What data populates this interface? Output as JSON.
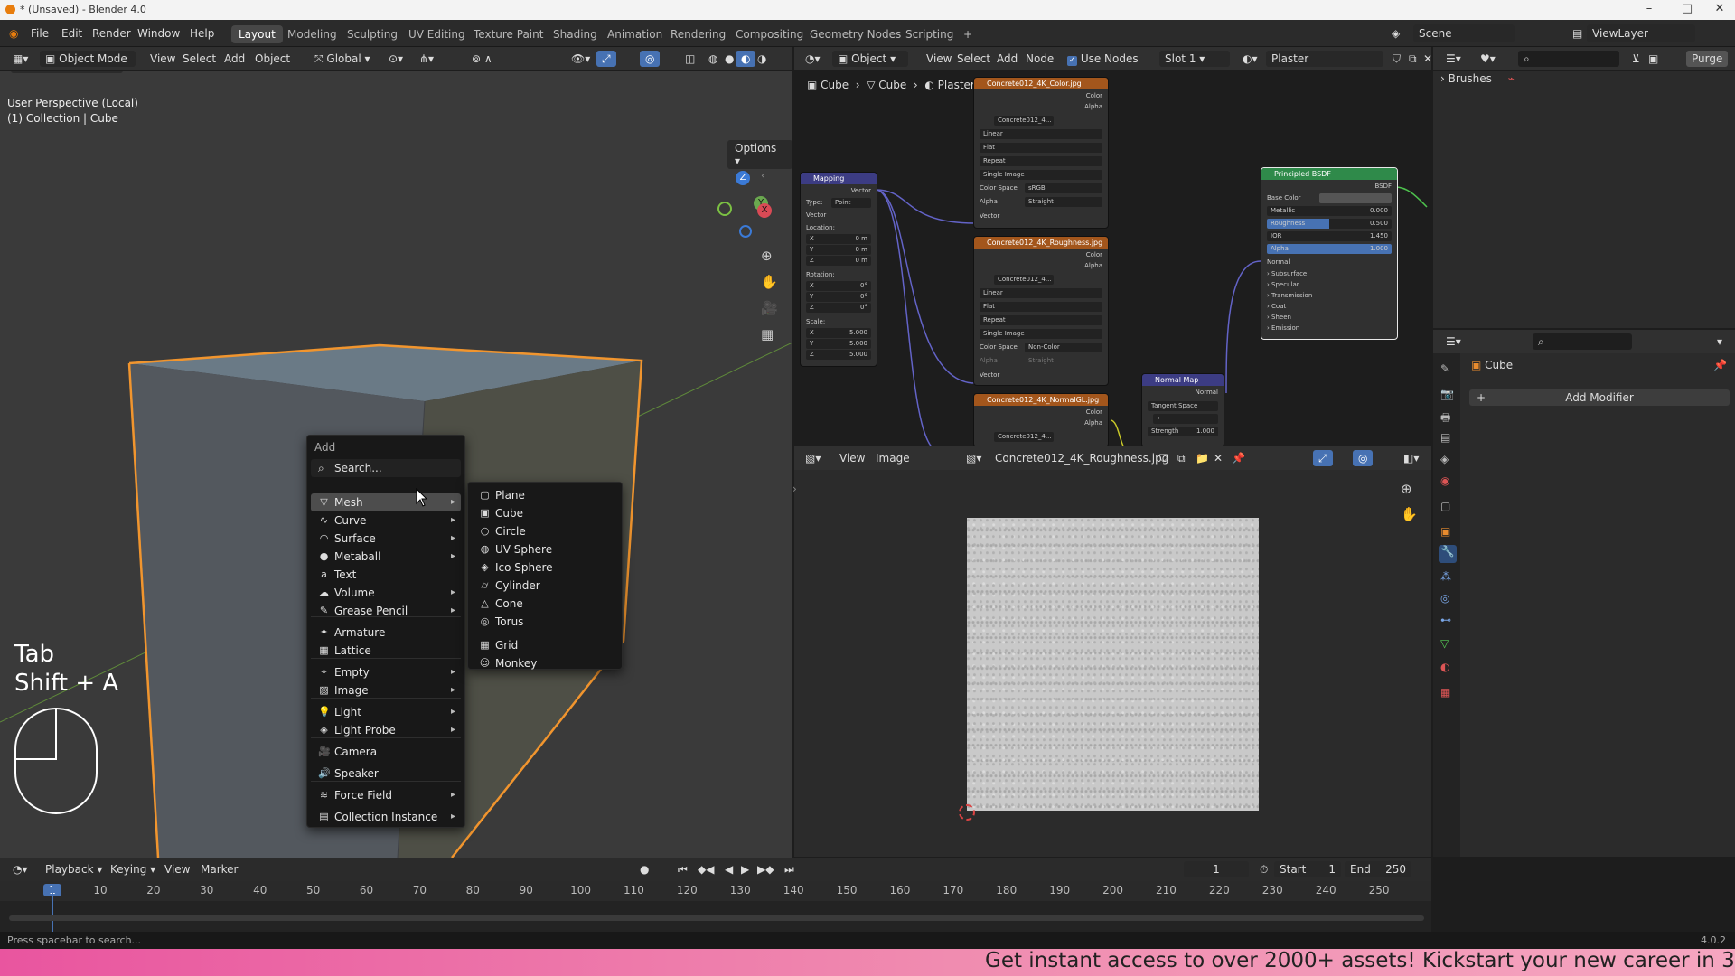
{
  "title_bar": {
    "title": "* (Unsaved) - Blender 4.0"
  },
  "top_menu": {
    "menus": [
      "File",
      "Edit",
      "Render",
      "Window",
      "Help"
    ],
    "workspaces": [
      "Layout",
      "Modeling",
      "Sculpting",
      "UV Editing",
      "Texture Paint",
      "Shading",
      "Animation",
      "Rendering",
      "Compositing",
      "Geometry Nodes",
      "Scripting",
      "+"
    ],
    "active_workspace": "Layout",
    "scene": "Scene",
    "view_layer": "ViewLayer"
  },
  "viewport_header": {
    "mode": "Object Mode",
    "menus": [
      "View",
      "Select",
      "Add",
      "Object"
    ],
    "transform_orientation": "Global",
    "options": "Options"
  },
  "viewport": {
    "perspective_label": "User Perspective (Local)",
    "collection_label": "(1) Collection | Cube",
    "key_hint_1": "Tab",
    "key_hint_2": "Shift + A",
    "gizmo": {
      "z": "Z",
      "y": "Y",
      "x": "X"
    }
  },
  "add_menu": {
    "title": "Add",
    "search": "Search...",
    "items": [
      {
        "label": "Mesh",
        "icon": "mesh-icon",
        "submenu": true
      },
      {
        "label": "Curve",
        "icon": "curve-icon",
        "submenu": true
      },
      {
        "label": "Surface",
        "icon": "surface-icon",
        "submenu": true
      },
      {
        "label": "Metaball",
        "icon": "metaball-icon",
        "submenu": true
      },
      {
        "label": "Text",
        "icon": "text-icon",
        "submenu": false
      },
      {
        "label": "Volume",
        "icon": "volume-icon",
        "submenu": true
      },
      {
        "label": "Grease Pencil",
        "icon": "grease-pencil-icon",
        "submenu": true
      },
      {
        "label": "Armature",
        "icon": "armature-icon",
        "submenu": false
      },
      {
        "label": "Lattice",
        "icon": "lattice-icon",
        "submenu": false
      },
      {
        "label": "Empty",
        "icon": "empty-icon",
        "submenu": true
      },
      {
        "label": "Image",
        "icon": "image-icon",
        "submenu": true
      },
      {
        "label": "Light",
        "icon": "light-icon",
        "submenu": true
      },
      {
        "label": "Light Probe",
        "icon": "light-probe-icon",
        "submenu": true
      },
      {
        "label": "Camera",
        "icon": "camera-icon",
        "submenu": false
      },
      {
        "label": "Speaker",
        "icon": "speaker-icon",
        "submenu": false
      },
      {
        "label": "Force Field",
        "icon": "force-field-icon",
        "submenu": true
      },
      {
        "label": "Collection Instance",
        "icon": "collection-icon",
        "submenu": true
      }
    ],
    "mesh_submenu": [
      "Plane",
      "Cube",
      "Circle",
      "UV Sphere",
      "Ico Sphere",
      "Cylinder",
      "Cone",
      "Torus",
      "Grid",
      "Monkey"
    ]
  },
  "node_header": {
    "object": "Object",
    "menus": [
      "View",
      "Select",
      "Add",
      "Node"
    ],
    "use_nodes": "Use Nodes",
    "slot": "Slot 1",
    "material": "Plaster"
  },
  "node_breadcrumb": [
    "Cube",
    "Cube",
    "Plaster"
  ],
  "nodes": {
    "mapping": {
      "title": "Mapping",
      "vector": "Vector",
      "type_label": "Type:",
      "type_value": "Point",
      "vector_in": "Vector",
      "location": "Location:",
      "loc": [
        "0 m",
        "0 m",
        "0 m"
      ],
      "rotation": "Rotation:",
      "rot": [
        "0°",
        "0°",
        "0°"
      ],
      "scale": "Scale:",
      "scl": [
        "5.000",
        "5.000",
        "5.000"
      ],
      "axes": [
        "X",
        "Y",
        "Z"
      ]
    },
    "color_tex": {
      "title": "Concrete012_4K_Color.jpg",
      "out1": "Color",
      "out2": "Alpha",
      "image": "Concrete012_4...",
      "interp": "Linear",
      "proj": "Flat",
      "ext": "Repeat",
      "source": "Single Image",
      "cs_label": "Color Space",
      "cs": "sRGB",
      "alpha_label": "Alpha",
      "alpha": "Straight",
      "vec": "Vector"
    },
    "rough_tex": {
      "title": "Concrete012_4K_Roughness.jpg",
      "out1": "Color",
      "out2": "Alpha",
      "image": "Concrete012_4...",
      "interp": "Linear",
      "proj": "Flat",
      "ext": "Repeat",
      "source": "Single Image",
      "cs_label": "Color Space",
      "cs": "Non-Color",
      "alpha_label": "Alpha",
      "alpha": "Straight",
      "vec": "Vector"
    },
    "normal_tex": {
      "title": "Concrete012_4K_NormalGL.jpg",
      "out1": "Color",
      "out2": "Alpha",
      "image": "Concrete012_4..."
    },
    "normal_map": {
      "title": "Normal Map",
      "out": "Normal",
      "space": "Tangent Space",
      "strength_label": "Strength",
      "strength": "1.000"
    },
    "bsdf": {
      "title": "Principled BSDF",
      "out": "BSDF",
      "base_color": "Base Color",
      "metallic": "Metallic",
      "metallic_v": "0.000",
      "roughness": "Roughness",
      "roughness_v": "0.500",
      "ior": "IOR",
      "ior_v": "1.450",
      "alpha": "Alpha",
      "alpha_v": "1.000",
      "normal": "Normal",
      "panels": [
        "Subsurface",
        "Specular",
        "Transmission",
        "Coat",
        "Sheen",
        "Emission"
      ]
    }
  },
  "image_editor": {
    "menus": [
      "View",
      "Image"
    ],
    "image_name": "Concrete012_4K_Roughness.jpg"
  },
  "outliner": {
    "item": "Brushes"
  },
  "properties": {
    "object_name": "Cube",
    "add_modifier": "Add Modifier",
    "purge": "Purge"
  },
  "timeline": {
    "menus": [
      "Playback",
      "Keying",
      "View",
      "Marker"
    ],
    "current_frame": "1",
    "start_label": "Start",
    "start": "1",
    "end_label": "End",
    "end": "250",
    "ticks": [
      "1",
      "10",
      "20",
      "30",
      "40",
      "50",
      "60",
      "70",
      "80",
      "90",
      "100",
      "110",
      "120",
      "130",
      "140",
      "150",
      "160",
      "170",
      "180",
      "190",
      "200",
      "210",
      "220",
      "230",
      "240",
      "250"
    ]
  },
  "status_bar": {
    "hint": "Press spacebar to search...",
    "version": "4.0.2"
  },
  "banner": {
    "text": "Get instant access to over 2000+ assets! Kickstart your new career in 3"
  }
}
